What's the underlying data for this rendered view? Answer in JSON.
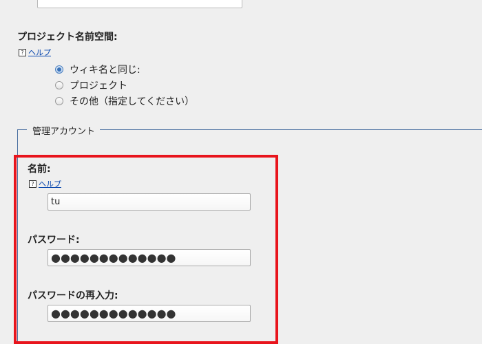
{
  "project_namespace": {
    "label": "プロジェクト名前空間:",
    "help_link": "ヘルプ",
    "options": [
      {
        "label": "ウィキ名と同じ:",
        "checked": true
      },
      {
        "label": "プロジェクト",
        "checked": false
      },
      {
        "label": "その他（指定してください）",
        "checked": false
      }
    ]
  },
  "admin_account": {
    "legend": "管理アカウント",
    "name_label": "名前:",
    "help_link": "ヘルプ",
    "name_value": "tu",
    "password_label": "パスワード:",
    "password_value": "●●●●●●●●●●●●●",
    "password_confirm_label": "パスワードの再入力:",
    "password_confirm_value": "●●●●●●●●●●●●●"
  },
  "icons": {
    "help": "help-icon",
    "radio": "radio-icon"
  },
  "colors": {
    "highlight": "#e8141c",
    "link": "#0645ad",
    "fieldset_border": "#4a6fa0"
  }
}
